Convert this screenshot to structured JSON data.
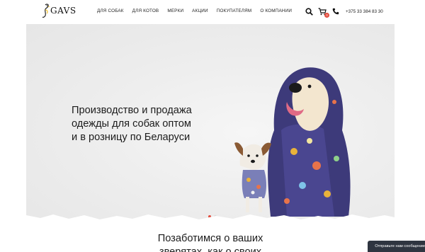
{
  "brand": {
    "name": "GAVS"
  },
  "nav": {
    "items": [
      {
        "label": "ДЛЯ СОБАК"
      },
      {
        "label": "ДЛЯ КОТОВ"
      },
      {
        "label": "МЕРКИ"
      },
      {
        "label": "АКЦИИ"
      },
      {
        "label": "ПОКУПАТЕЛЯМ"
      },
      {
        "label": "О КОМПАНИИ"
      }
    ]
  },
  "header_icons": {
    "search": "search-icon",
    "cart": "cart-icon",
    "phone": "phone-icon",
    "cart_count": "0"
  },
  "contact": {
    "phone": "+375 33 384 83 30"
  },
  "hero": {
    "title_lines": [
      "Производство и продажа",
      "одежды для собак оптом",
      "и в розницу по Беларуси"
    ],
    "slides": {
      "count": 2,
      "active": 1
    }
  },
  "section": {
    "title_lines": [
      "Позаботимся о ваших",
      "зверятах, как о своих"
    ]
  },
  "chat": {
    "label": "Отправьте нам сообщение"
  },
  "colors": {
    "accent": "#e24a3b",
    "hero_bg": "#ededed",
    "chat_bg": "#2f3540",
    "coat": "#3d3a7a"
  }
}
